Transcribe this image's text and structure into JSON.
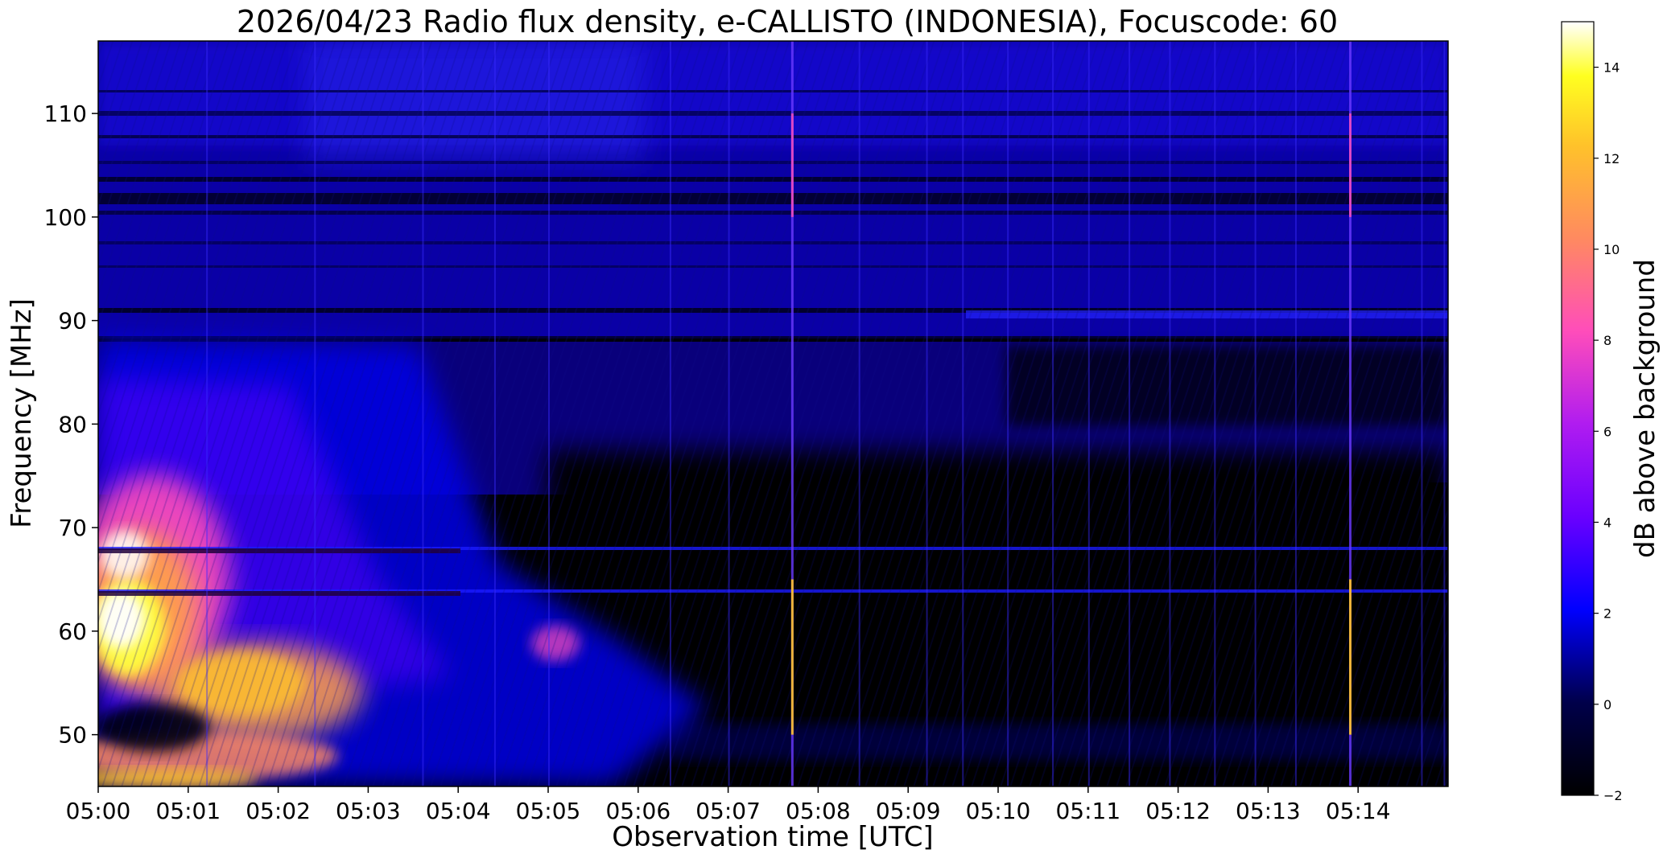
{
  "chart_data": {
    "type": "heatmap",
    "title": "2026/04/23  Radio flux density, e-CALLISTO (INDONESIA), Focuscode: 60",
    "xlabel": "Observation time [UTC]",
    "ylabel": "Frequency [MHz]",
    "x_tick_labels": [
      "05:00",
      "05:01",
      "05:02",
      "05:03",
      "05:04",
      "05:05",
      "05:06",
      "05:07",
      "05:08",
      "05:09",
      "05:10",
      "05:11",
      "05:12",
      "05:13",
      "05:14"
    ],
    "x_range_minutes": [
      0,
      15
    ],
    "y_ticks": [
      50,
      60,
      70,
      80,
      90,
      100,
      110
    ],
    "y_range_mhz": [
      45,
      117
    ],
    "colorbar": {
      "label": "dB above background",
      "colormap": "gnuplot2",
      "range": [
        -2,
        15
      ],
      "ticks": [
        -2,
        0,
        2,
        4,
        6,
        8,
        10,
        12,
        14
      ],
      "stops": [
        "#000000",
        "#0000ff",
        "#8b00ff",
        "#ff4dba",
        "#ffa048",
        "#ffff00",
        "#ffffff"
      ]
    },
    "features": {
      "burst": {
        "description_source": "visual estimate of emission",
        "points": [
          {
            "t_min": 0.0,
            "f_mhz": 70,
            "db": 13
          },
          {
            "t_min": 0.3,
            "f_mhz": 62,
            "db": 15
          },
          {
            "t_min": 1.0,
            "f_mhz": 56,
            "db": 11
          },
          {
            "t_min": 2.0,
            "f_mhz": 53,
            "db": 9
          },
          {
            "t_min": 5.2,
            "f_mhz": 58,
            "db": 6
          }
        ]
      },
      "spikes_t_min": [
        7.7,
        13.9
      ],
      "rfi_lines_mhz": [
        88,
        90.5,
        101,
        103
      ]
    },
    "grid": false
  }
}
